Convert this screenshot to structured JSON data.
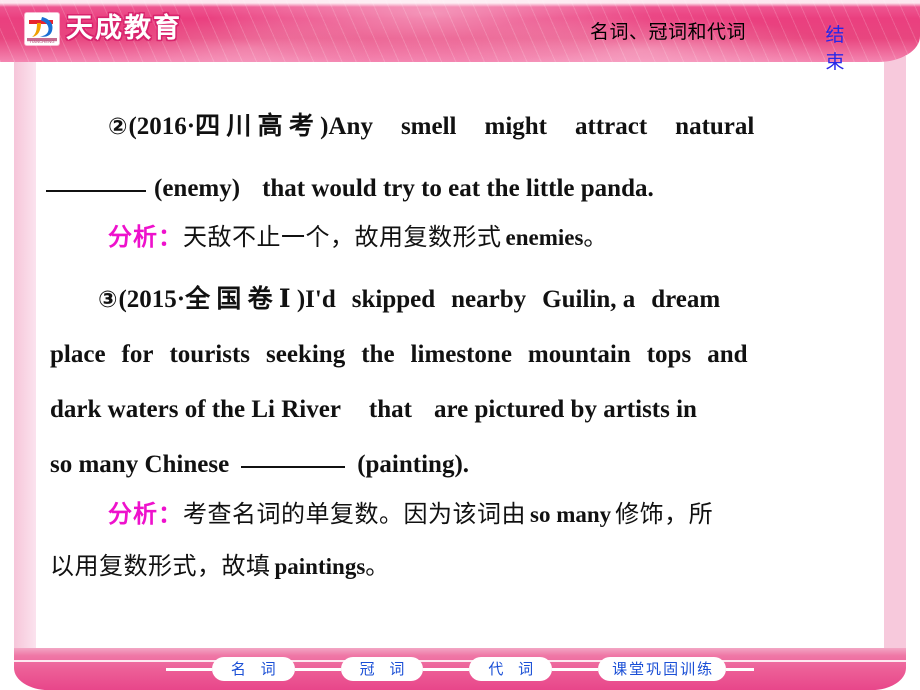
{
  "header": {
    "brand_name": "天成教育",
    "brand_mark_caption": "TIANCHENG",
    "title": "名词、冠词和代词",
    "end_button": "结束"
  },
  "content": {
    "item2": {
      "marker": "②",
      "source": "(2016·四 川 高 考 )",
      "text_a": "Any",
      "text_b": "smell",
      "text_c": "might",
      "text_d": "attract",
      "text_e": "natural",
      "blank": "________",
      "cue": "(enemy)",
      "text_f": "that would try to eat the little panda."
    },
    "analysis1": {
      "label": "分析：",
      "text_a": "天敌不止一个，故用复数形式",
      "answer": "enemies",
      "period": "。"
    },
    "item3": {
      "marker": "③",
      "source": "(2015·全 国 卷 Ⅰ )",
      "line1_a": "I'd",
      "line1_b": "skipped",
      "line1_c": "nearby",
      "line1_d": "Guilin, a",
      "line1_e": "dream",
      "line2_a": "place",
      "line2_b": "for",
      "line2_c": "tourists",
      "line2_d": "seeking",
      "line2_e": "the",
      "line2_f": "limestone",
      "line2_g": "mountain",
      "line2_h": "tops",
      "line2_i": "and",
      "line3_a": "dark waters of the Li River",
      "line3_b": "that",
      "line3_c": "are pictured by artists in",
      "line4_a": "so many Chinese",
      "line4_blank": "________",
      "line4_b": "(painting)."
    },
    "analysis2": {
      "label": "分析：",
      "text_a": "考查名词的单复数。因为该词由",
      "emph": "so many",
      "text_b": "修饰，所",
      "text_c": "以用复数形式，故填",
      "answer": "paintings",
      "period": "。"
    }
  },
  "footer": {
    "nav": [
      {
        "label": "名 词"
      },
      {
        "label": "冠 词"
      },
      {
        "label": "代 词"
      },
      {
        "label": "课堂巩固训练"
      }
    ]
  },
  "colors": {
    "brand_pink": "#e8467f",
    "frame_pink": "#f7c9dc",
    "nav_text_blue": "#1a4fd6",
    "end_blue": "#2727e8",
    "analysis_magenta": "#ee11cc",
    "body_black": "#111111"
  }
}
